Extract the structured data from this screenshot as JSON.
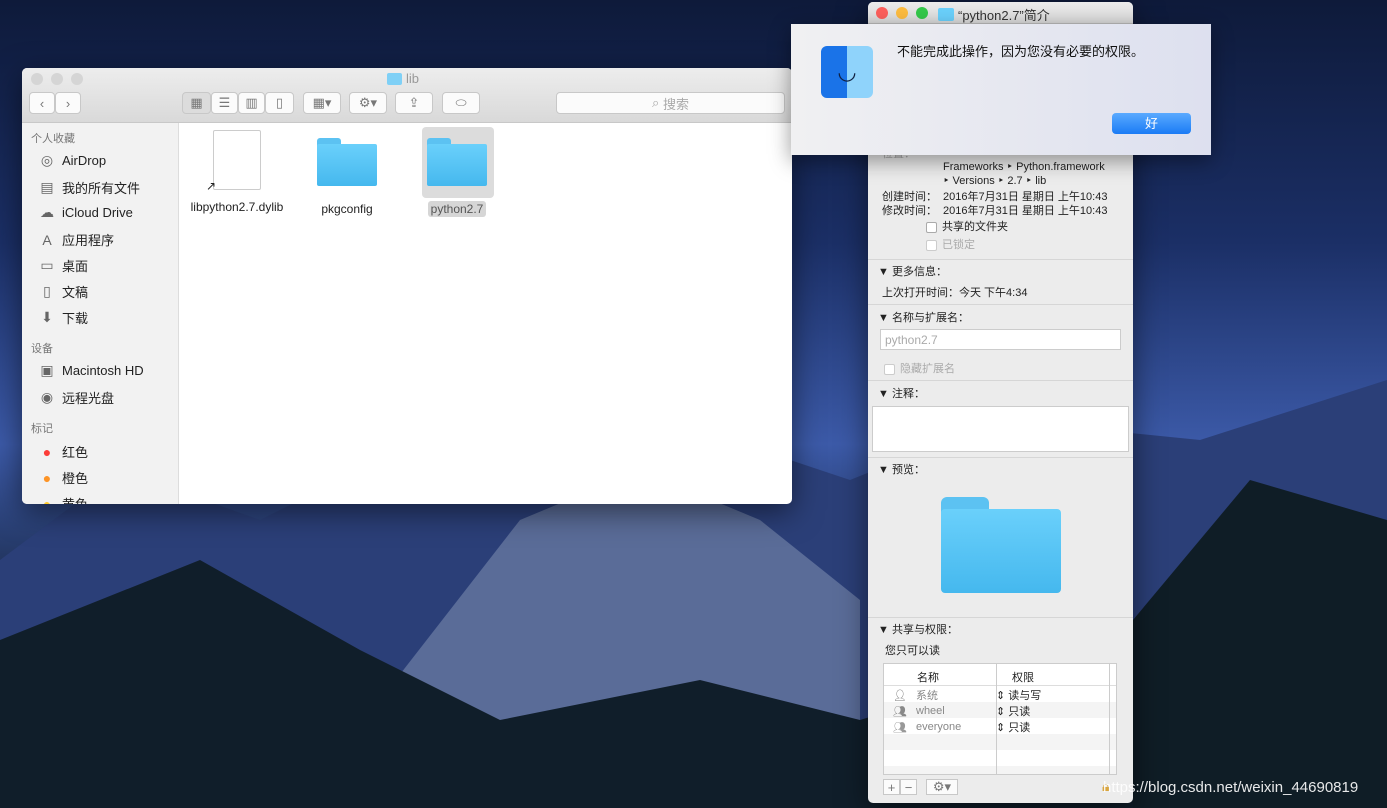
{
  "finder": {
    "title": "lib",
    "search_placeholder": "搜索",
    "sidebar": {
      "favorites_header": "个人收藏",
      "favorites": [
        {
          "label": "AirDrop",
          "icon": "airdrop-icon"
        },
        {
          "label": "我的所有文件",
          "icon": "all-files-icon"
        },
        {
          "label": "iCloud Drive",
          "icon": "cloud-icon"
        },
        {
          "label": "应用程序",
          "icon": "applications-icon"
        },
        {
          "label": "桌面",
          "icon": "desktop-icon"
        },
        {
          "label": "文稿",
          "icon": "documents-icon"
        },
        {
          "label": "下载",
          "icon": "download-icon"
        }
      ],
      "devices_header": "设备",
      "devices": [
        {
          "label": "Macintosh HD",
          "icon": "disk-icon"
        },
        {
          "label": "远程光盘",
          "icon": "optical-disc-icon"
        }
      ],
      "tags_header": "标记",
      "tags": [
        {
          "label": "红色",
          "color": "#fc3d39"
        },
        {
          "label": "橙色",
          "color": "#fd9426"
        },
        {
          "label": "黄色",
          "color": "#fecb2e"
        }
      ]
    },
    "files": [
      {
        "name": "libpython2.7.dylib",
        "type": "alias-file"
      },
      {
        "name": "pkgconfig",
        "type": "folder"
      },
      {
        "name": "python2.7",
        "type": "folder",
        "selected": true
      }
    ]
  },
  "info": {
    "title": "“python2.7”简介",
    "where_label": "位置：",
    "where_path": [
      "Frameworks ‣ Python.framework",
      "‣ Versions ‣ 2.7 ‣ lib"
    ],
    "created_label": "创建时间：",
    "created": "2016年7月31日 星期日 上午10:43",
    "modified_label": "修改时间：",
    "modified": "2016年7月31日 星期日 上午10:43",
    "shared_folder": "共享的文件夹",
    "locked": "已锁定",
    "more_info_header": "更多信息：",
    "last_opened_label": "上次打开时间：",
    "last_opened": "今天 下午4:34",
    "name_ext_header": "名称与扩展名：",
    "name_value": "python2.7",
    "hide_ext": "隐藏扩展名",
    "comments_header": "注释：",
    "preview_header": "预览：",
    "sharing_header": "共享与权限：",
    "sharing_status": "您只可以读",
    "perm_columns": [
      "名称",
      "权限"
    ],
    "perms": [
      {
        "name": "系统",
        "privilege": "读与写"
      },
      {
        "name": "wheel",
        "privilege": "只读"
      },
      {
        "name": "everyone",
        "privilege": "只读"
      }
    ]
  },
  "alert": {
    "message": "不能完成此操作，因为您没有必要的权限。",
    "ok_label": "好"
  },
  "watermark": "https://blog.csdn.net/weixin_44690819"
}
